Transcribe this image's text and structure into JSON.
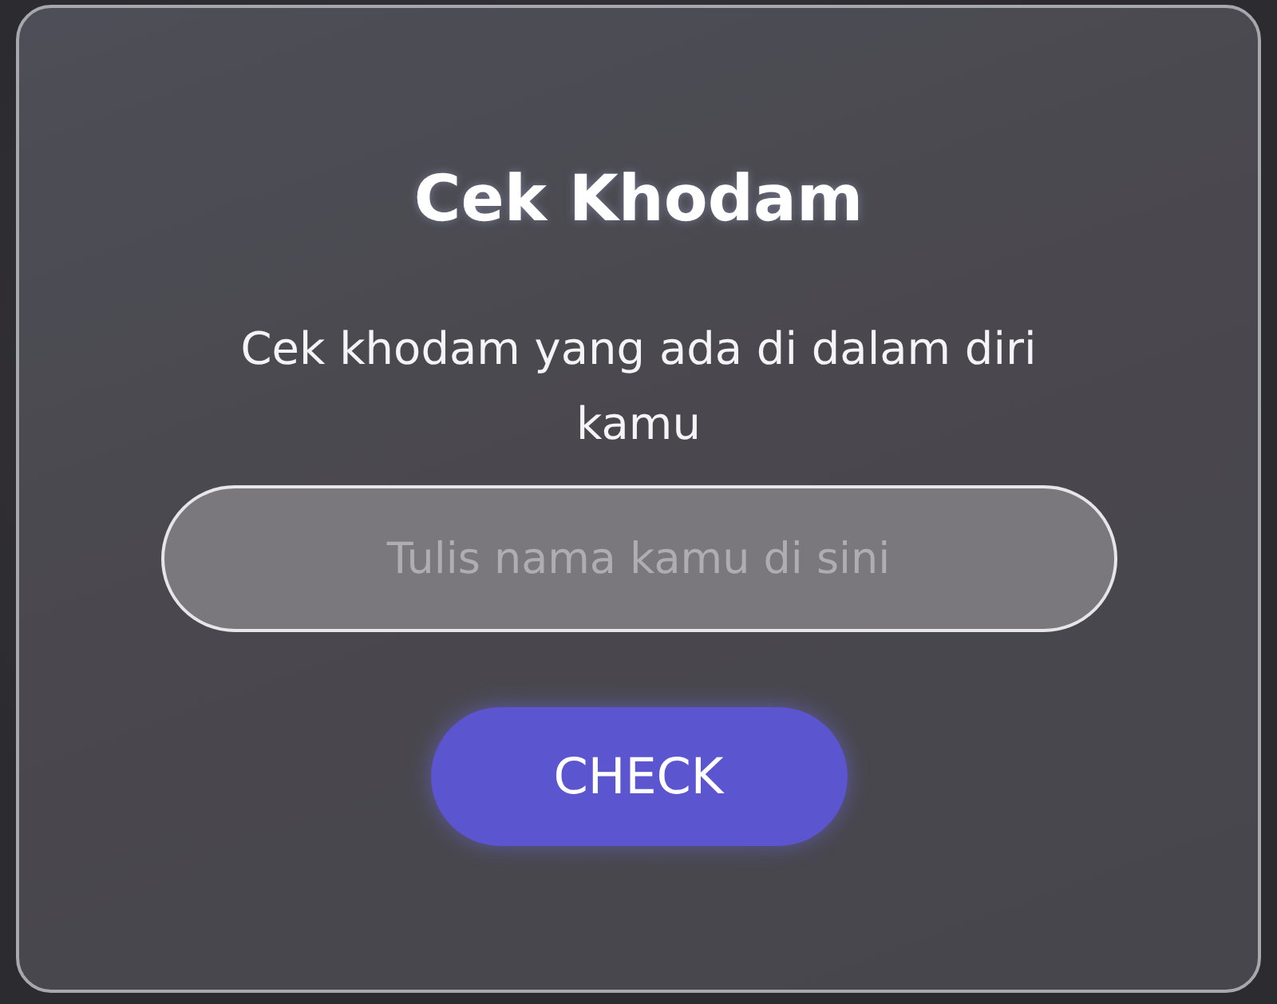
{
  "card": {
    "title": "Cek Khodam",
    "subtitle": "Cek khodam yang ada di dalam diri kamu",
    "name_field": {
      "placeholder": "Tulis nama kamu di sini"
    },
    "button": "CHECK"
  }
}
